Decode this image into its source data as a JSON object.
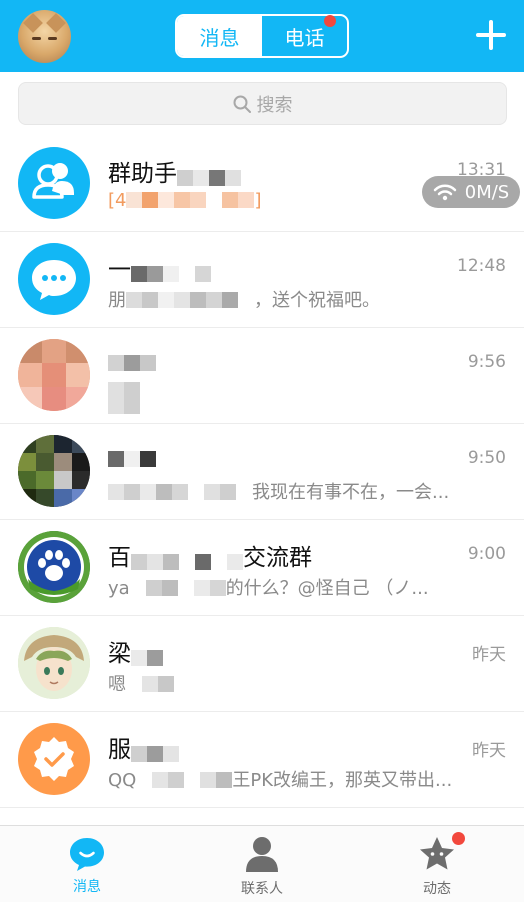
{
  "header": {
    "tabs": [
      {
        "label": "消息",
        "active": true
      },
      {
        "label": "电话",
        "active": false,
        "has_badge": true
      }
    ],
    "accent_color": "#12b7f5",
    "badge_color": "#f2483d"
  },
  "search": {
    "placeholder": "搜索"
  },
  "network": {
    "speed": "0M/S"
  },
  "conversations": [
    {
      "name": "群助手",
      "time": "13:31",
      "preview": "[4",
      "preview_tail": "]",
      "avatar": "group-assistant-icon"
    },
    {
      "name": "一",
      "time": "12:48",
      "preview": "朋",
      "preview_tail": "，送个祝福吧。",
      "avatar": "chat-bubble-icon"
    },
    {
      "name": "",
      "time": "9:56",
      "preview": "",
      "avatar": "photo-avatar"
    },
    {
      "name": "",
      "time": "9:50",
      "preview": "",
      "preview_tail": "我现在有事不在，一会...",
      "avatar": "photo-avatar"
    },
    {
      "name": "百",
      "name_tail": "交流群",
      "time": "9:00",
      "preview": "ya",
      "preview_tail": "的什么？@怪自己 （ノ...",
      "avatar": "paw-logo"
    },
    {
      "name": "梁",
      "time": "昨天",
      "preview": "嗯",
      "avatar": "anime-avatar"
    },
    {
      "name": "服",
      "time": "昨天",
      "preview": "QQ",
      "preview_tail": "王PK改编王，那英又带出...",
      "avatar": "service-badge-icon"
    }
  ],
  "tabbar": {
    "items": [
      {
        "label": "消息",
        "active": true
      },
      {
        "label": "联系人",
        "active": false
      },
      {
        "label": "动态",
        "active": false,
        "has_badge": true
      }
    ]
  }
}
